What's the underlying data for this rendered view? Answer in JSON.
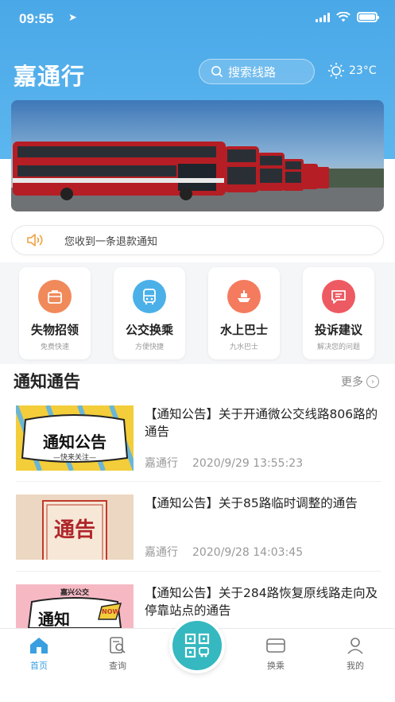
{
  "status": {
    "time": "09:55"
  },
  "header": {
    "title": "嘉通行",
    "search_placeholder": "搜索线路",
    "temperature": "23°C"
  },
  "notice": {
    "text": "您收到一条退款通知"
  },
  "services": [
    {
      "label": "失物招领",
      "sub": "免费快速",
      "color": "#f08a5a",
      "icon": "bag-icon"
    },
    {
      "label": "公交换乘",
      "sub": "方便快捷",
      "color": "#4cb0e8",
      "icon": "bus-icon"
    },
    {
      "label": "水上巴士",
      "sub": "九水巴士",
      "color": "#f47b5e",
      "icon": "boat-icon"
    },
    {
      "label": "投诉建议",
      "sub": "解决您的问题",
      "color": "#ee5a62",
      "icon": "message-icon"
    }
  ],
  "section": {
    "title": "通知通告",
    "more": "更多"
  },
  "news": [
    {
      "title": "【通知公告】关于开通微公交线路806路的通告",
      "source": "嘉通行",
      "date": "2020/9/29 13:55:23",
      "thumb_text": "通知公告",
      "thumb_sub": "—快来关注—"
    },
    {
      "title": "【通知公告】关于85路临时调整的通告",
      "source": "嘉通行",
      "date": "2020/9/28 14:03:45",
      "thumb_text": "通告"
    },
    {
      "title": "【通知公告】关于284路恢复原线路走向及停靠站点的通告",
      "thumb_text": "通知",
      "thumb_top": "嘉兴公交",
      "thumb_badge": "NOW"
    }
  ],
  "tabs": [
    {
      "label": "首页",
      "icon": "home-icon"
    },
    {
      "label": "查询",
      "icon": "query-icon"
    },
    {
      "label": "换乘",
      "icon": "card-icon"
    },
    {
      "label": "我的",
      "icon": "user-icon"
    }
  ],
  "colors": {
    "primary": "#4aa8e8",
    "active_tab": "#3a9fe0",
    "center_button": "#35b8c0"
  }
}
